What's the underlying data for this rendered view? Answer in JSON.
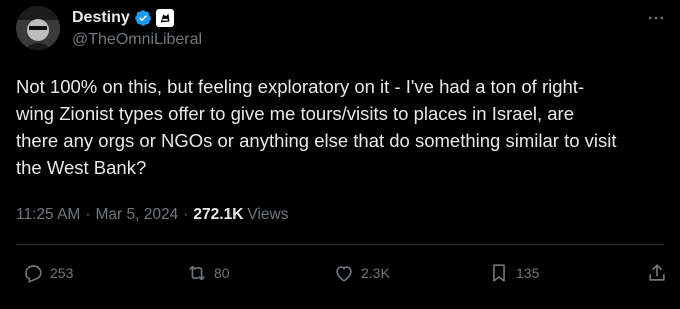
{
  "author": {
    "display_name": "Destiny",
    "handle": "@TheOmniLiberal",
    "verified_icon": "verified-badge-icon",
    "affiliation_icon": "affiliation-badge-icon"
  },
  "tweet": {
    "text": "Not 100% on this, but feeling exploratory on it - I've had a ton of right-\nwing Zionist types offer to give me tours/visits to places in Israel, are\nthere any orgs or NGOs or anything else that do something similar to visit\nthe West Bank?",
    "time": "11:25 AM",
    "separator": "·",
    "date": "Mar 5, 2024",
    "views_count": "272.1K",
    "views_label": "Views"
  },
  "actions": {
    "replies": "253",
    "reposts": "80",
    "likes": "2.3K",
    "bookmarks": "135"
  },
  "colors": {
    "background": "#000000",
    "text": "#e7e9ea",
    "muted": "#71767b",
    "verified": "#1d9bf0",
    "divider": "#2f3336"
  }
}
